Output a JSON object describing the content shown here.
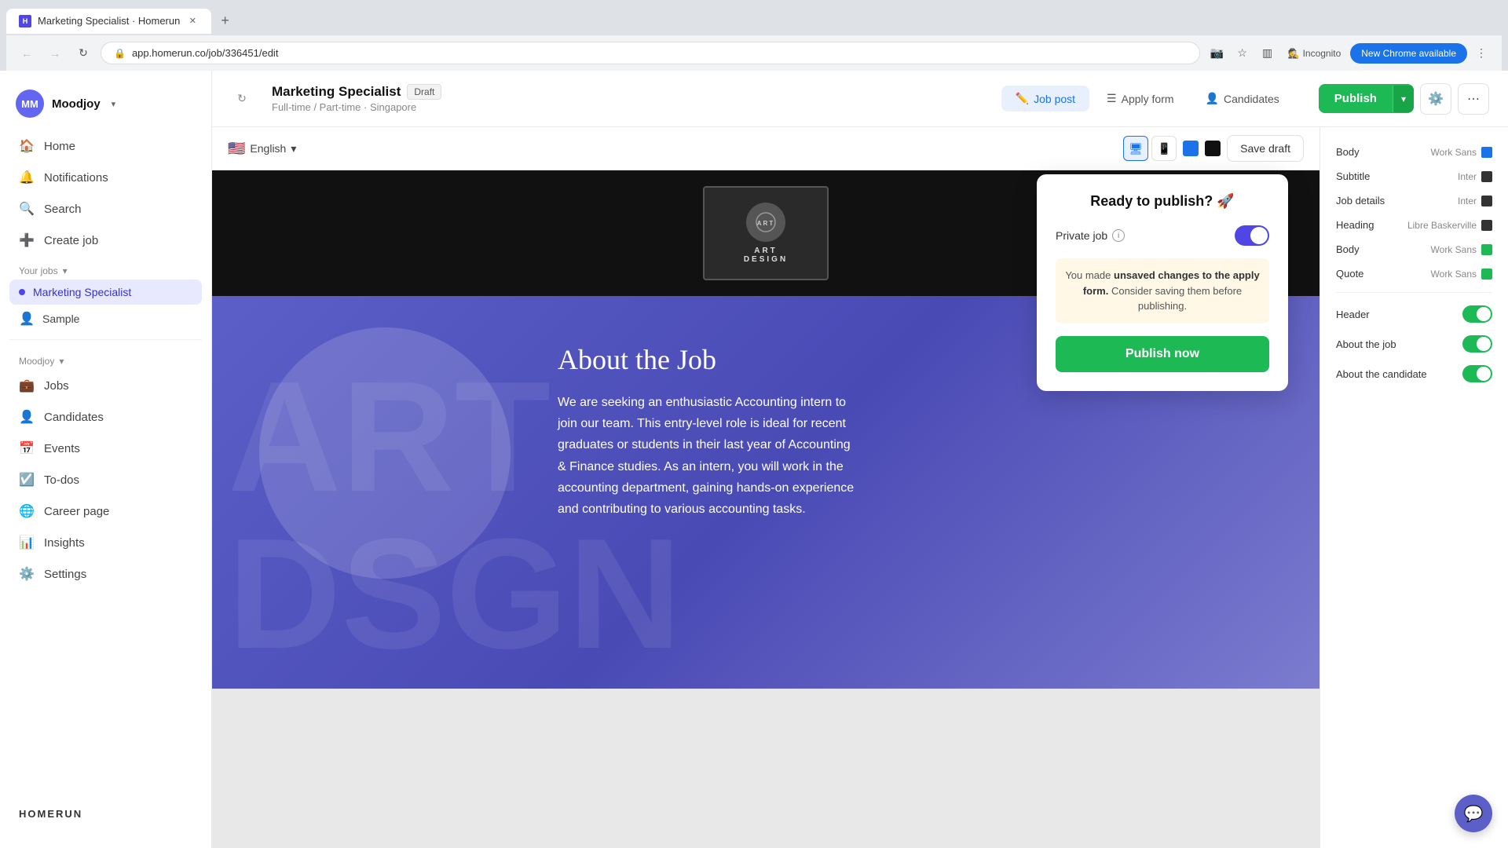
{
  "browser": {
    "tab_title": "Marketing Specialist · Homerun",
    "url": "app.homerun.co/job/336451/edit",
    "new_chrome_label": "New Chrome available",
    "incognito_label": "Incognito"
  },
  "topbar": {
    "job_name": "Marketing Specialist",
    "draft_badge": "Draft",
    "job_subtitle": "Full-time / Part-time · Singapore",
    "tabs": [
      {
        "label": "Job post",
        "icon": "✏️",
        "active": true
      },
      {
        "label": "Apply form",
        "icon": "☰",
        "active": false
      },
      {
        "label": "Candidates",
        "icon": "👤",
        "active": false
      }
    ],
    "publish_label": "Publish",
    "save_draft_label": "Save draft"
  },
  "sidebar": {
    "org_name": "Moodjoy",
    "avatar_initials": "MM",
    "nav_items": [
      {
        "label": "Home",
        "icon": "🏠"
      },
      {
        "label": "Notifications",
        "icon": "🔔"
      },
      {
        "label": "Search",
        "icon": "🔍"
      },
      {
        "label": "Create job",
        "icon": "➕"
      }
    ],
    "your_jobs_label": "Your jobs",
    "jobs": [
      {
        "label": "Marketing Specialist",
        "active": true
      },
      {
        "label": "Sample",
        "active": false
      }
    ],
    "org_section_label": "Moodjoy",
    "org_items": [
      {
        "label": "Jobs",
        "icon": "💼"
      },
      {
        "label": "Candidates",
        "icon": "👤"
      },
      {
        "label": "Events",
        "icon": "📅"
      },
      {
        "label": "To-dos",
        "icon": "☑️"
      },
      {
        "label": "Career page",
        "icon": "🌐"
      },
      {
        "label": "Insights",
        "icon": "📊"
      },
      {
        "label": "Settings",
        "icon": "⚙️"
      }
    ],
    "logo": "HOMERUN"
  },
  "preview": {
    "language": "English",
    "about_job_title": "About the Job",
    "job_description": "We are seeking an enthusiastic Accounting intern to join our team. This entry-level role is ideal for recent graduates or students in their last year of Accounting & Finance studies. As an intern, you will work in the accounting department, gaining hands-on experience and contributing to various accounting tasks."
  },
  "right_panel": {
    "rows": [
      {
        "label": "Body",
        "font": "Work Sans",
        "color": "#1a73e8"
      },
      {
        "label": "Subtitle",
        "font": "Inter",
        "color": "#333"
      },
      {
        "label": "Job details",
        "font": "Inter",
        "color": "#333"
      },
      {
        "label": "Heading",
        "font": "Libre Baskerville",
        "color": "#333"
      },
      {
        "label": "Body",
        "font": "Work Sans",
        "color": "#1db954"
      },
      {
        "label": "Quote",
        "font": "Work Sans",
        "color": "#1db954"
      }
    ],
    "toggles": [
      {
        "label": "Header",
        "on": true
      },
      {
        "label": "About the job",
        "on": true
      },
      {
        "label": "About the candidate",
        "on": true
      }
    ]
  },
  "publish_popup": {
    "title": "Ready to publish? 🚀",
    "private_job_label": "Private job",
    "unsaved_notice": "You made unsaved changes to the apply form. Consider saving them before publishing.",
    "publish_now_label": "Publish now"
  }
}
